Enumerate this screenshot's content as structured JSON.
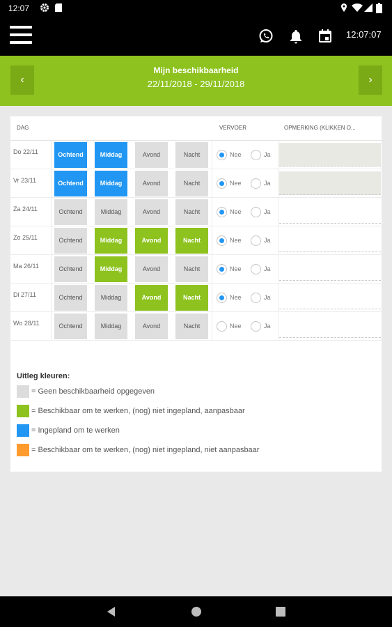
{
  "status": {
    "time": "12:07"
  },
  "toolbar": {
    "clock": "12:07:07"
  },
  "header": {
    "title": "Mijn beschikbaarheid",
    "dates": "22/11/2018  - 29/11/2018"
  },
  "table": {
    "headers": {
      "day": "DAG",
      "transport": "VERVOER",
      "remark": "OPMERKING (KLIKKEN O..."
    },
    "slot_labels": [
      "Ochtend",
      "Middag",
      "Avond",
      "Nacht"
    ],
    "radio_labels": {
      "no": "Nee",
      "yes": "Ja"
    },
    "rows": [
      {
        "day": "Do 22/11",
        "slots": [
          "Ochtend",
          "Middag",
          "Avond",
          "Nacht"
        ],
        "states": [
          "blue",
          "blue",
          "gray",
          "gray"
        ],
        "transport": "Nee",
        "remark": ""
      },
      {
        "day": "Vr 23/11",
        "slots": [
          "Ochtend",
          "Middag",
          "Avond",
          "Nacht"
        ],
        "states": [
          "blue",
          "blue",
          "gray",
          "gray"
        ],
        "transport": "Nee",
        "remark": ""
      },
      {
        "day": "Za 24/11",
        "slots": [
          "Ochtend",
          "Middag",
          "Avond",
          "Nacht"
        ],
        "states": [
          "gray",
          "gray",
          "gray",
          "gray"
        ],
        "transport": "Nee",
        "remark": ""
      },
      {
        "day": "Zo 25/11",
        "slots": [
          "Ochtend",
          "Middag",
          "Avond",
          "Nacht"
        ],
        "states": [
          "gray",
          "green",
          "green",
          "green"
        ],
        "transport": "Nee",
        "remark": ""
      },
      {
        "day": "Ma 26/11",
        "slots": [
          "Ochtend",
          "Middag",
          "Avond",
          "Nacht"
        ],
        "states": [
          "gray",
          "green",
          "gray",
          "gray"
        ],
        "transport": "Nee",
        "remark": ""
      },
      {
        "day": "Di 27/11",
        "slots": [
          "Ochtend",
          "Middag",
          "Avond",
          "Nacht"
        ],
        "states": [
          "gray",
          "gray",
          "green",
          "green"
        ],
        "transport": "Nee",
        "remark": ""
      },
      {
        "day": "Wo 28/11",
        "slots": [
          "Ochtend",
          "Middag",
          "Avond",
          "Nacht"
        ],
        "states": [
          "gray",
          "gray",
          "gray",
          "gray"
        ],
        "transport": "",
        "remark": ""
      }
    ]
  },
  "legend": {
    "title": "Uitleg kleuren:",
    "items": [
      {
        "color": "#dcdcdc",
        "text": "= Geen beschikbaarheid opgegeven"
      },
      {
        "color": "#8dc21f",
        "text": "= Beschikbaar om te werken, (nog) niet ingepland, aanpasbaar"
      },
      {
        "color": "#2196f3",
        "text": "= Ingepland om te werken"
      },
      {
        "color": "#ff9a2e",
        "text": "= Beschikbaar om te werken, (nog) niet ingepland, niet aanpasbaar"
      }
    ]
  },
  "colors": {
    "brand_green": "#8dc21f",
    "planned_blue": "#2196f3",
    "unavailable_gray": "#dedede",
    "locked_orange": "#ff9a2e"
  },
  "icons": [
    "settings-icon",
    "sd-card-icon",
    "location-icon",
    "wifi-icon",
    "signal-icon",
    "battery-icon",
    "menu-icon",
    "whatsapp-icon",
    "bell-icon",
    "calendar-icon",
    "chevron-left-icon",
    "chevron-right-icon",
    "back-icon",
    "home-icon",
    "recents-icon"
  ]
}
